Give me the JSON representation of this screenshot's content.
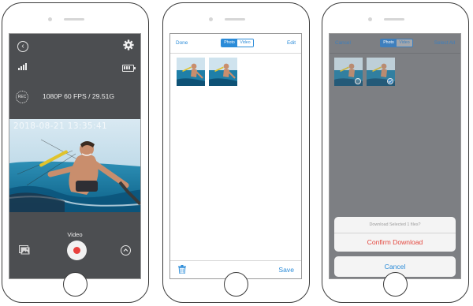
{
  "camera_screen": {
    "resolution_info": "1080P 60 FPS / 29.51G",
    "rec_label": "REC",
    "timestamp": "2018-08-21   13:35:41",
    "mode_label": "Video",
    "icons": [
      "back-icon",
      "gear-icon",
      "signal-icon",
      "battery-icon",
      "recording-status-icon",
      "gallery-icon",
      "record-button",
      "chevron-up-icon"
    ]
  },
  "gallery_screen": {
    "left_action": "Done",
    "right_action": "Edit",
    "segment_photo": "Photo",
    "segment_video": "Video",
    "save_label": "Save",
    "icons": [
      "trash-icon"
    ],
    "accent_color": "#2a8bd8"
  },
  "selection_screen": {
    "left_action": "Cancel",
    "right_action": "Select All",
    "segment_photo": "Photo",
    "segment_video": "Video",
    "sheet_title": "Download Selected 1 files?",
    "confirm_label": "Confirm Download",
    "cancel_label": "Cancel",
    "destructive_color": "#e4473e"
  }
}
